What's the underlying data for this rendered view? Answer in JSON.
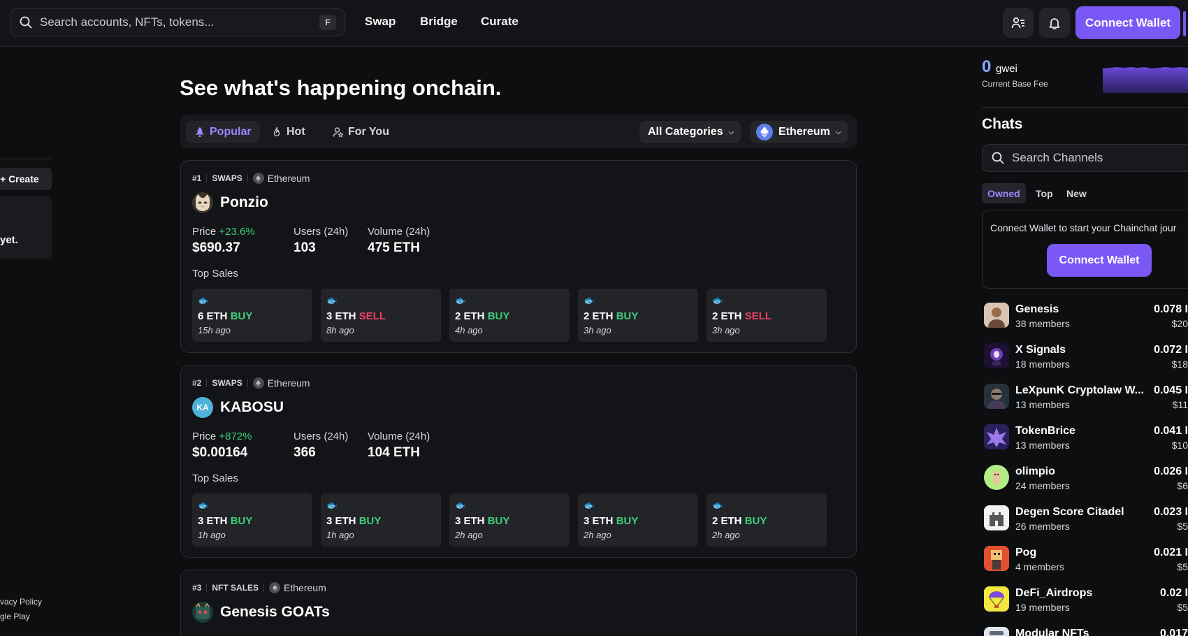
{
  "header": {
    "search_placeholder": "Search accounts, NFTs, tokens...",
    "search_shortcut": "F",
    "nav": [
      "Swap",
      "Bridge",
      "Curate"
    ],
    "connect_wallet": "Connect Wallet",
    "accent_color": "#7a58f5"
  },
  "left": {
    "create_label": "+ Create",
    "card_text": "yet.",
    "links": [
      "vacy Policy",
      "gle Play"
    ]
  },
  "main": {
    "heading": "See what's happening onchain.",
    "tabs": [
      {
        "label": "Popular",
        "icon": "rocket-icon",
        "active": true
      },
      {
        "label": "Hot",
        "icon": "flame-icon",
        "active": false
      },
      {
        "label": "For You",
        "icon": "user-star-icon",
        "active": false
      }
    ],
    "category_dropdown": "All Categories",
    "chain_dropdown": "Ethereum",
    "cards": [
      {
        "rank": "#1",
        "category": "SWAPS",
        "chain": "Ethereum",
        "name": "Ponzio",
        "avatar": "cat-face",
        "price_label": "Price",
        "price_change": "+23.6%",
        "price": "$690.37",
        "users_label": "Users (24h)",
        "users": "103",
        "volume_label": "Volume (24h)",
        "volume": "475 ETH",
        "top_sales_label": "Top Sales",
        "sales": [
          {
            "amount": "6 ETH",
            "side": "BUY",
            "time": "15h ago"
          },
          {
            "amount": "3 ETH",
            "side": "SELL",
            "time": "8h ago"
          },
          {
            "amount": "2 ETH",
            "side": "BUY",
            "time": "4h ago"
          },
          {
            "amount": "2 ETH",
            "side": "BUY",
            "time": "3h ago"
          },
          {
            "amount": "2 ETH",
            "side": "SELL",
            "time": "3h ago"
          }
        ]
      },
      {
        "rank": "#2",
        "category": "SWAPS",
        "chain": "Ethereum",
        "name": "KABOSU",
        "avatar_text": "KA",
        "price_label": "Price",
        "price_change": "+872%",
        "price": "$0.00164",
        "users_label": "Users (24h)",
        "users": "366",
        "volume_label": "Volume (24h)",
        "volume": "104 ETH",
        "top_sales_label": "Top Sales",
        "sales": [
          {
            "amount": "3 ETH",
            "side": "BUY",
            "time": "1h ago"
          },
          {
            "amount": "3 ETH",
            "side": "BUY",
            "time": "1h ago"
          },
          {
            "amount": "3 ETH",
            "side": "BUY",
            "time": "2h ago"
          },
          {
            "amount": "3 ETH",
            "side": "BUY",
            "time": "2h ago"
          },
          {
            "amount": "2 ETH",
            "side": "BUY",
            "time": "2h ago"
          }
        ]
      },
      {
        "rank": "#3",
        "category": "NFT SALES",
        "chain": "Ethereum",
        "name": "Genesis GOATs",
        "avatar": "goat-art"
      }
    ]
  },
  "sidebar": {
    "gwei_value": "0",
    "gwei_unit": "gwei",
    "base_fee_label": "Current Base Fee",
    "chats_title": "Chats",
    "search_placeholder": "Search Channels",
    "tabs": [
      "Owned",
      "Top",
      "New"
    ],
    "connect_message": "Connect Wallet to start your Chainchat jour",
    "connect_button": "Connect Wallet",
    "chats": [
      {
        "name": "Genesis",
        "members": "38 members",
        "price": "0.078 I",
        "usd": "$20",
        "icon": "portrait-avatar"
      },
      {
        "name": "X Signals",
        "members": "18 members",
        "price": "0.072 I",
        "usd": "$18",
        "icon": "ghost-avatar"
      },
      {
        "name": "LeXpunK Cryptolaw W...",
        "members": "13 members",
        "price": "0.045 I",
        "usd": "$11",
        "icon": "punk-avatar"
      },
      {
        "name": "TokenBrice",
        "members": "13 members",
        "price": "0.041 I",
        "usd": "$10",
        "icon": "emblem-avatar"
      },
      {
        "name": "olimpio",
        "members": "24 members",
        "price": "0.026 I",
        "usd": "$6",
        "icon": "cartoon-avatar"
      },
      {
        "name": "Degen Score Citadel",
        "members": "26 members",
        "price": "0.023 I",
        "usd": "$5",
        "icon": "castle-avatar"
      },
      {
        "name": "Pog",
        "members": "4 members",
        "price": "0.021 I",
        "usd": "$5",
        "icon": "pixel-avatar"
      },
      {
        "name": "DeFi_Airdrops",
        "members": "19 members",
        "price": "0.02 I",
        "usd": "$5",
        "icon": "parachute-avatar"
      },
      {
        "name": "Modular NFTs",
        "members": "",
        "price": "0.017",
        "usd": "",
        "icon": "nft-avatar"
      }
    ]
  }
}
